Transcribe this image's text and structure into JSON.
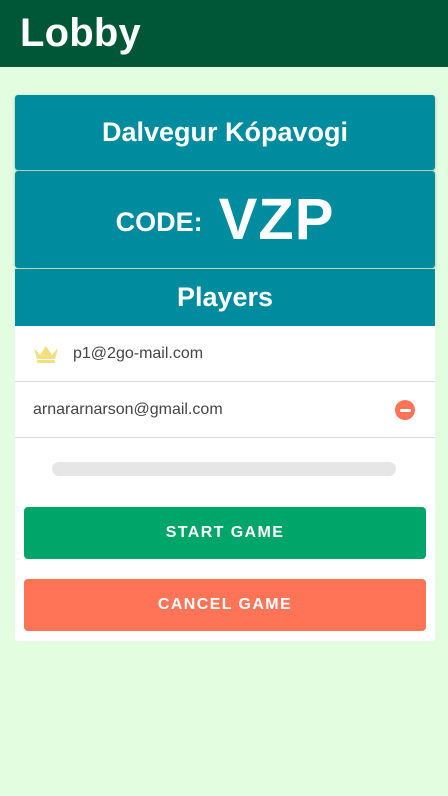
{
  "header": {
    "title": "Lobby"
  },
  "lobby": {
    "name": "Dalvegur Kópavogi",
    "code_label": "CODE:",
    "code": "VZP"
  },
  "players": {
    "heading": "Players",
    "list": [
      {
        "email": "p1@2go-mail.com",
        "icon": "crown-icon"
      },
      {
        "email": "arnararnarson@gmail.com",
        "icon": "remove-icon"
      }
    ]
  },
  "actions": {
    "start_label": "START GAME",
    "cancel_label": "CANCEL GAME"
  },
  "colors": {
    "topbar": "#005737",
    "background": "#e2fde0",
    "card": "#008c9f",
    "start": "#00a569",
    "cancel": "#ff7357",
    "crown": "#f3df7e"
  }
}
